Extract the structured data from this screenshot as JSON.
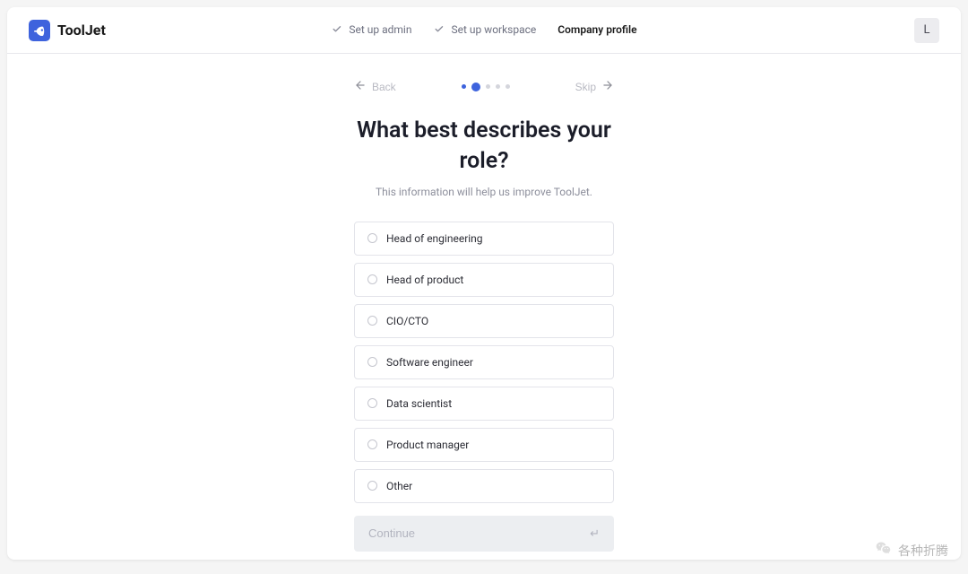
{
  "brand": {
    "name": "ToolJet"
  },
  "header": {
    "steps": [
      {
        "label": "Set up admin",
        "done": true,
        "active": false
      },
      {
        "label": "Set up workspace",
        "done": true,
        "active": false
      },
      {
        "label": "Company profile",
        "done": false,
        "active": true
      }
    ],
    "avatar_initial": "L"
  },
  "nav": {
    "back_label": "Back",
    "skip_label": "Skip"
  },
  "progress": {
    "total_dots": 5,
    "current_index": 1
  },
  "question": {
    "title": "What best describes your role?",
    "subtitle": "This information will help us improve ToolJet."
  },
  "options": [
    {
      "label": "Head of engineering"
    },
    {
      "label": "Head of product"
    },
    {
      "label": "CIO/CTO"
    },
    {
      "label": "Software engineer"
    },
    {
      "label": "Data scientist"
    },
    {
      "label": "Product manager"
    },
    {
      "label": "Other"
    }
  ],
  "continue": {
    "label": "Continue",
    "enabled": false
  },
  "watermark": {
    "text": "各种折腾"
  }
}
